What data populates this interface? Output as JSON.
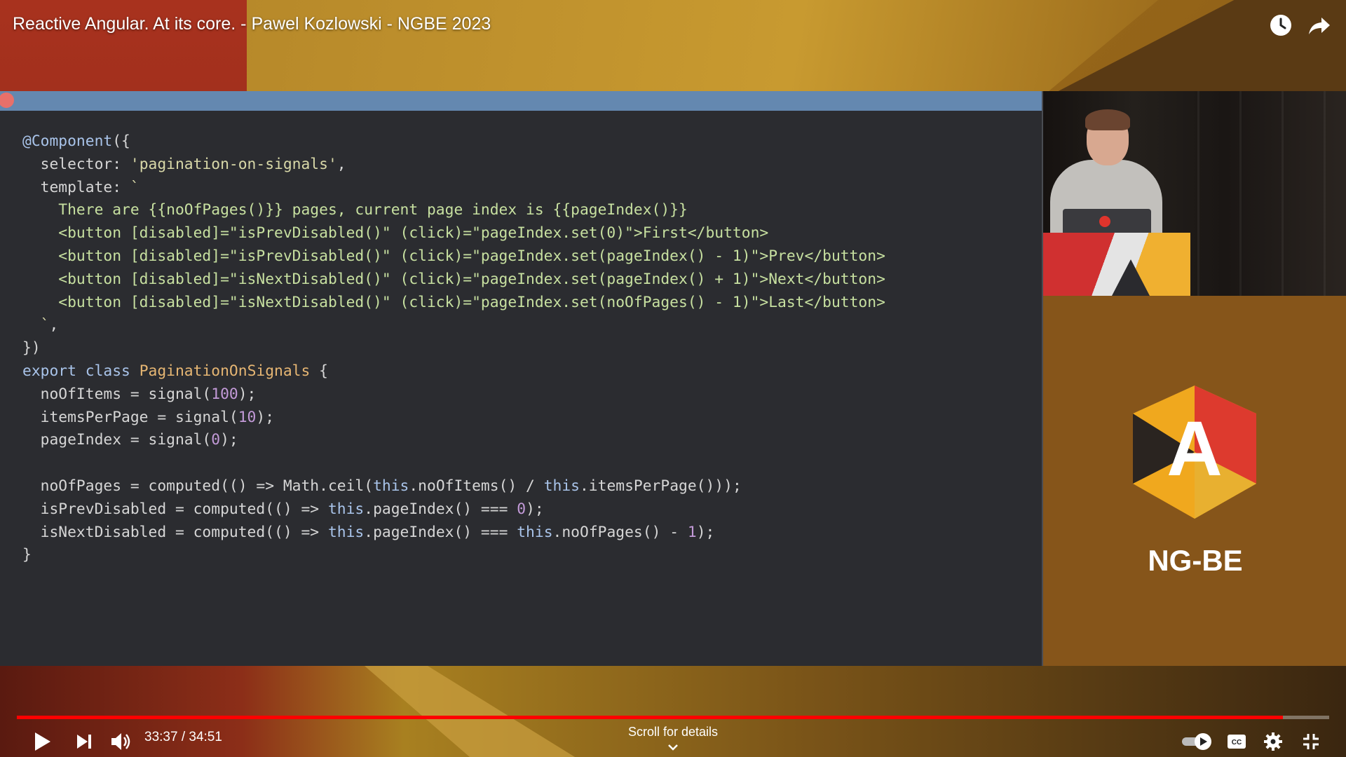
{
  "player": {
    "title": "Reactive Angular. At its core. - Pawel Kozlowski - NGBE 2023",
    "current_time": "33:37",
    "duration": "34:51",
    "time_display": "33:37 / 34:51",
    "progress_fraction": 0.965,
    "scroll_hint": "Scroll for details",
    "accent_color": "#ff0000"
  },
  "icons": {
    "watch_later": "clock-icon",
    "share": "share-icon",
    "play": "play-icon",
    "next": "next-icon",
    "volume": "volume-icon",
    "autoplay": "autoplay-toggle-icon",
    "captions": "captions-icon",
    "settings": "gear-icon",
    "exit_fullscreen": "exit-fullscreen-icon",
    "scroll": "chevron-down-icon"
  },
  "slide": {
    "code_lines": [
      "@Component({",
      "  selector: 'pagination-on-signals',",
      "  template: `",
      "    There are {{noOfPages()}} pages, current page index is {{pageIndex()}}",
      "    <button [disabled]=\"isPrevDisabled()\" (click)=\"pageIndex.set(0)\">First</button>",
      "    <button [disabled]=\"isPrevDisabled()\" (click)=\"pageIndex.set(pageIndex() - 1)\">Prev</button>",
      "    <button [disabled]=\"isNextDisabled()\" (click)=\"pageIndex.set(pageIndex() + 1)\">Next</button>",
      "    <button [disabled]=\"isNextDisabled()\" (click)=\"pageIndex.set(noOfPages() - 1)\">Last</button>",
      "  `,",
      "})",
      "export class PaginationOnSignals {",
      "  noOfItems = signal(100);",
      "  itemsPerPage = signal(10);",
      "  pageIndex = signal(0);",
      "",
      "  noOfPages = computed(() => Math.ceil(this.noOfItems() / this.itemsPerPage()));",
      "  isPrevDisabled = computed(() => this.pageIndex() === 0);",
      "  isNextDisabled = computed(() => this.pageIndex() === this.noOfPages() - 1);",
      "}"
    ]
  },
  "branding": {
    "logo_letter": "A",
    "name": "NG-BE"
  }
}
